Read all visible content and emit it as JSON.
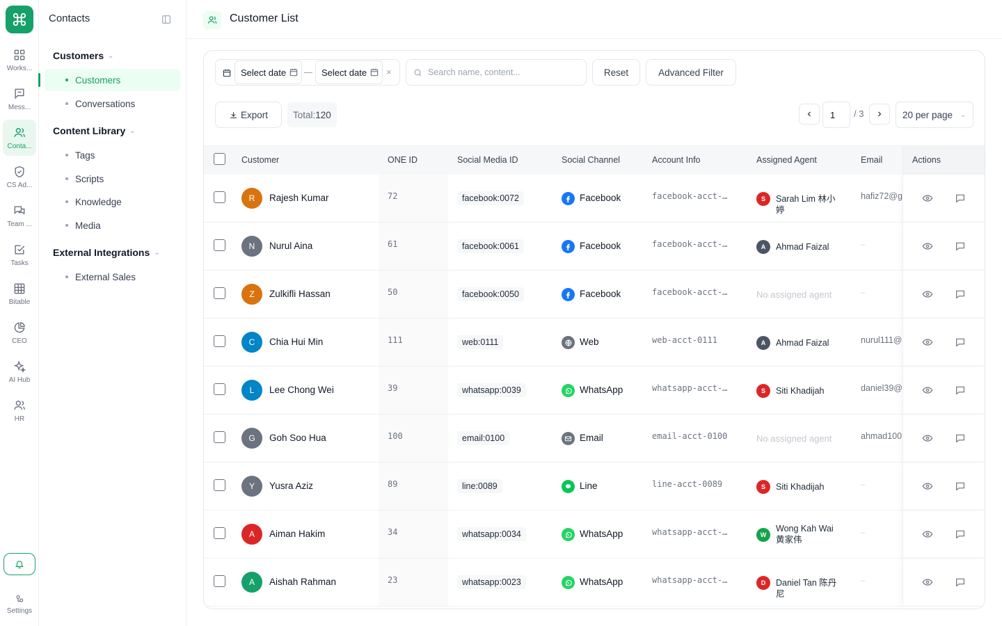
{
  "rail": {
    "items": [
      {
        "label": "Works...",
        "icon": "grid-icon"
      },
      {
        "label": "Mess...",
        "icon": "message-icon"
      },
      {
        "label": "Conta...",
        "icon": "users-icon",
        "active": true
      },
      {
        "label": "CS Ad...",
        "icon": "shield-check-icon"
      },
      {
        "label": "Team ...",
        "icon": "chat-bubbles-icon"
      },
      {
        "label": "Tasks",
        "icon": "task-check-icon"
      },
      {
        "label": "Bitable",
        "icon": "table-icon"
      },
      {
        "label": "CEO",
        "icon": "pie-chart-icon"
      },
      {
        "label": "AI Hub",
        "icon": "sparkles-icon"
      },
      {
        "label": "HR",
        "icon": "people-icon"
      }
    ],
    "settings_label": "Settings"
  },
  "sidebar": {
    "title": "Contacts",
    "groups": [
      {
        "label": "Customers",
        "items": [
          "Customers",
          "Conversations"
        ]
      },
      {
        "label": "Content Library",
        "items": [
          "Tags",
          "Scripts",
          "Knowledge",
          "Media"
        ]
      },
      {
        "label": "External Integrations",
        "items": [
          "External Sales"
        ]
      }
    ]
  },
  "header": {
    "title": "Customer List"
  },
  "toolbar": {
    "start_date": "Select date",
    "end_date": "Select date",
    "search_placeholder": "Search name, content...",
    "reset_label": "Reset",
    "advanced_label": "Advanced Filter"
  },
  "subbar": {
    "export_label": "Export",
    "total_label": "Total:",
    "total_value": "120",
    "page": "1",
    "page_total": "/ 3",
    "per_page": "20 per page"
  },
  "table": {
    "columns": [
      "Customer",
      "ONE ID",
      "Social Media ID",
      "Social Channel",
      "Account Info",
      "Assigned Agent",
      "Email",
      "Actions"
    ],
    "rows": [
      {
        "initial": "R",
        "avatar_color": "#d9730d",
        "name": "Rajesh Kumar",
        "one_id": "72",
        "social_id": "facebook:0072",
        "channel": "Facebook",
        "account": "facebook-acct-…",
        "agent_initial": "S",
        "agent_color": "#dc2626",
        "agent": "Sarah Lim 林小婷",
        "email": "hafiz72@g"
      },
      {
        "initial": "N",
        "avatar_color": "#6b7280",
        "name": "Nurul Aina",
        "one_id": "61",
        "social_id": "facebook:0061",
        "channel": "Facebook",
        "account": "facebook-acct-…",
        "agent_initial": "A",
        "agent_color": "#4b5563",
        "agent": "Ahmad Faizal",
        "email": "–"
      },
      {
        "initial": "Z",
        "avatar_color": "#d9730d",
        "name": "Zulkifli Hassan",
        "one_id": "50",
        "social_id": "facebook:0050",
        "channel": "Facebook",
        "account": "facebook-acct-…",
        "agent_initial": "",
        "agent_color": "",
        "agent": "No assigned agent",
        "email": "–"
      },
      {
        "initial": "C",
        "avatar_color": "#0284c7",
        "name": "Chia Hui Min",
        "one_id": "111",
        "social_id": "web:0111",
        "channel": "Web",
        "account": "web-acct-0111",
        "agent_initial": "A",
        "agent_color": "#4b5563",
        "agent": "Ahmad Faizal",
        "email": "nurul111@"
      },
      {
        "initial": "L",
        "avatar_color": "#0284c7",
        "name": "Lee Chong Wei",
        "one_id": "39",
        "social_id": "whatsapp:0039",
        "channel": "WhatsApp",
        "account": "whatsapp-acct-…",
        "agent_initial": "S",
        "agent_color": "#dc2626",
        "agent": "Siti Khadijah",
        "email": "daniel39@"
      },
      {
        "initial": "G",
        "avatar_color": "#6b7280",
        "name": "Goh Soo Hua",
        "one_id": "100",
        "social_id": "email:0100",
        "channel": "Email",
        "account": "email-acct-0100",
        "agent_initial": "",
        "agent_color": "",
        "agent": "No assigned agent",
        "email": "ahmad100"
      },
      {
        "initial": "Y",
        "avatar_color": "#6b7280",
        "name": "Yusra Aziz",
        "one_id": "89",
        "social_id": "line:0089",
        "channel": "Line",
        "account": "line-acct-0089",
        "agent_initial": "S",
        "agent_color": "#dc2626",
        "agent": "Siti Khadijah",
        "email": "–"
      },
      {
        "initial": "A",
        "avatar_color": "#dc2626",
        "name": "Aiman Hakim",
        "one_id": "34",
        "social_id": "whatsapp:0034",
        "channel": "WhatsApp",
        "account": "whatsapp-acct-…",
        "agent_initial": "W",
        "agent_color": "#16a34a",
        "agent": "Wong Kah Wai 黄家伟",
        "email": "–"
      },
      {
        "initial": "A",
        "avatar_color": "#16a06a",
        "name": "Aishah Rahman",
        "one_id": "23",
        "social_id": "whatsapp:0023",
        "channel": "WhatsApp",
        "account": "whatsapp-acct-…",
        "agent_initial": "D",
        "agent_color": "#dc2626",
        "agent": "Daniel Tan 陈丹尼",
        "email": "–"
      }
    ]
  },
  "colors": {
    "accent": "#16a06a",
    "facebook": "#1877f2",
    "whatsapp": "#25d366",
    "line": "#06c755"
  }
}
